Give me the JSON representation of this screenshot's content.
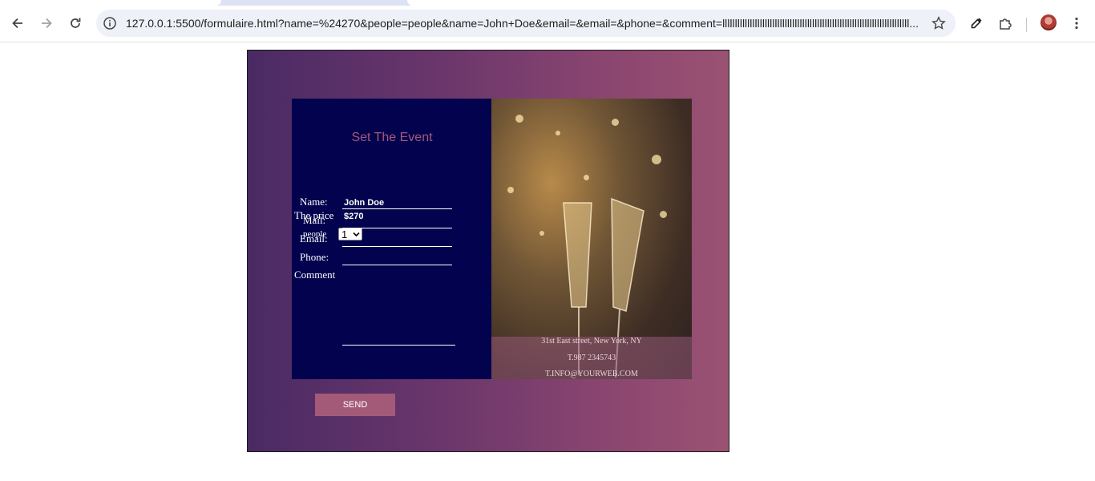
{
  "browser": {
    "url": "127.0.0.1:5500/formulaire.html?name=%24270&people=people&name=John+Doe&email=&email=&phone=&comment=lllllllllllllllllllllllllllllllllllllllllllllllllllllllllllllllllllllllllll...",
    "icons": [
      "back-icon",
      "forward-icon",
      "reload-icon",
      "info-icon",
      "star-icon",
      "eyedropper-icon",
      "extensions-icon",
      "menu-icon"
    ]
  },
  "form": {
    "title": "Set The Event",
    "price_label": "The price",
    "price_value": "$270",
    "people_label": "people",
    "people_selected": "1",
    "name_label": "Name:",
    "name_value": "John Doe",
    "mail_label": "Mail:",
    "mail_value": "",
    "email_label": "Email:",
    "email_value": "",
    "phone_label": "Phone:",
    "phone_value": "",
    "comment_label": "Comment",
    "send_label": "SEND"
  },
  "photo": {
    "address": "31st East street, New York, NY",
    "phone": "T.987 2345743",
    "email": "T.INFO@YOURWEB.COM"
  },
  "colors": {
    "panel": "#03024e",
    "accent": "#a35a78",
    "gradient_start": "#4a2a64",
    "gradient_end": "#9b5272"
  }
}
